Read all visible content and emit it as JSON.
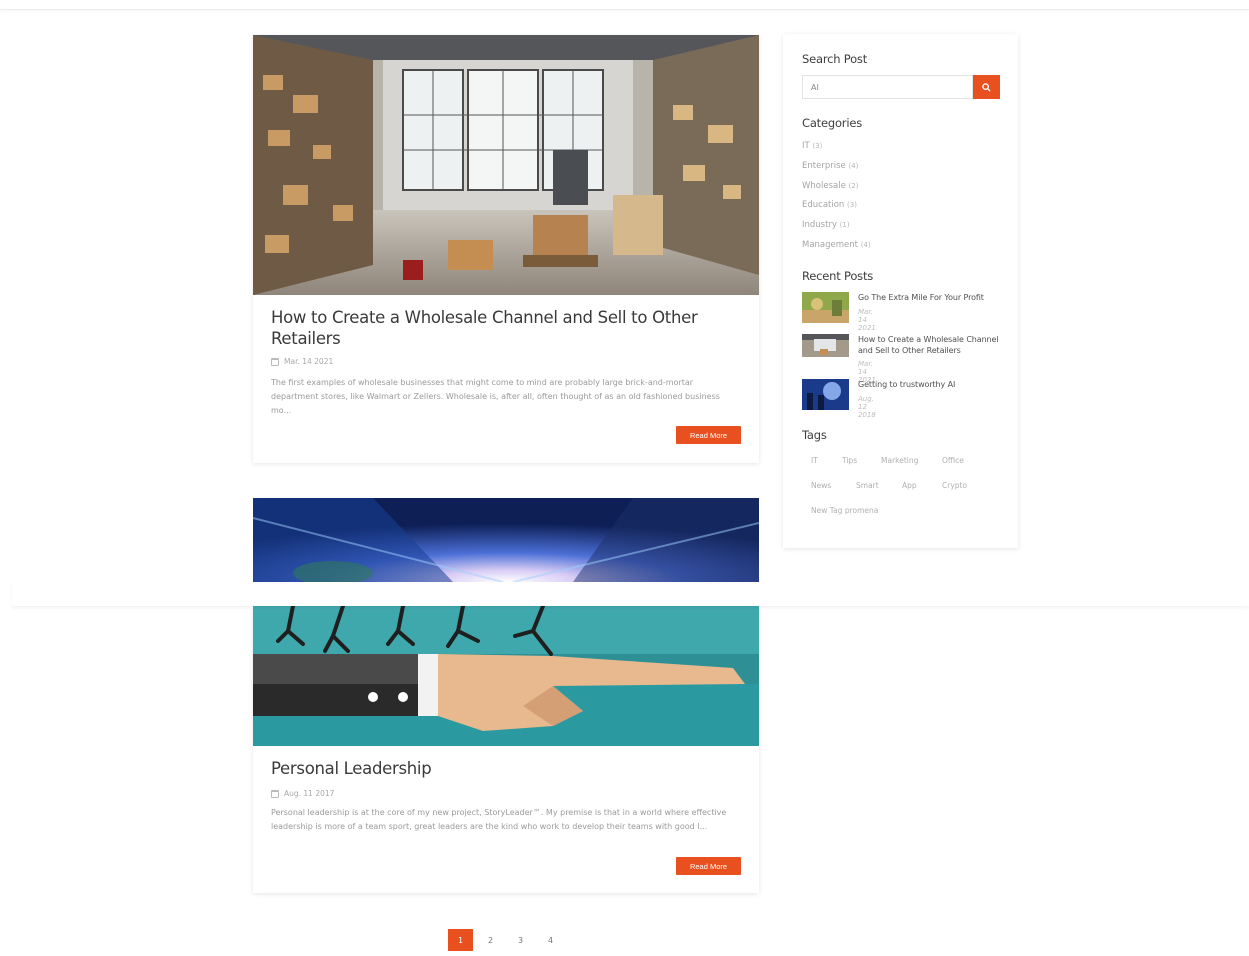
{
  "posts": [
    {
      "title": "How to Create a Wholesale Channel and Sell to Other Retailers",
      "date": "Mar. 14 2021",
      "excerpt": "The first examples of wholesale businesses that might come to mind are probably large brick-and-mortar department stores, like Walmart or Zellers. Wholesale is, after all, often thought of as an old fashioned business mo...",
      "button": "Read More"
    },
    {
      "title": "Personal Leadership",
      "date": "Aug. 11 2017",
      "excerpt": "Personal leadership is at the core of my new project, StoryLeader™. My premise is that in a world where effective leadership is more of a team sport, great leaders are the kind who work to develop their teams with good l...",
      "button": "Read More"
    }
  ],
  "sidebar": {
    "search_heading": "Search Post",
    "search_value": "AI",
    "categories_heading": "Categories",
    "categories": [
      {
        "name": "IT",
        "count": "(3)"
      },
      {
        "name": "Enterprise",
        "count": "(4)"
      },
      {
        "name": "Wholesale",
        "count": "(2)"
      },
      {
        "name": "Education",
        "count": "(3)"
      },
      {
        "name": "Industry",
        "count": "(1)"
      },
      {
        "name": "Management",
        "count": "(4)"
      }
    ],
    "recent_heading": "Recent Posts",
    "recent": [
      {
        "title": "Go The Extra Mile For Your Profit",
        "date": "Mar. 14 2021"
      },
      {
        "title": "How to Create a Wholesale Channel and Sell to Other Retailers",
        "date": "Mar. 14 2021"
      },
      {
        "title": "Getting to trustworthy AI",
        "date": "Aug. 12 2018"
      }
    ],
    "tags_heading": "Tags",
    "tags": [
      "IT",
      "Tips",
      "Marketing",
      "Office",
      "News",
      "Smart",
      "App",
      "Crypto",
      "New Tag promena"
    ]
  },
  "pagination": [
    "1",
    "2",
    "3",
    "4"
  ],
  "colors": {
    "accent": "#e8501f"
  }
}
